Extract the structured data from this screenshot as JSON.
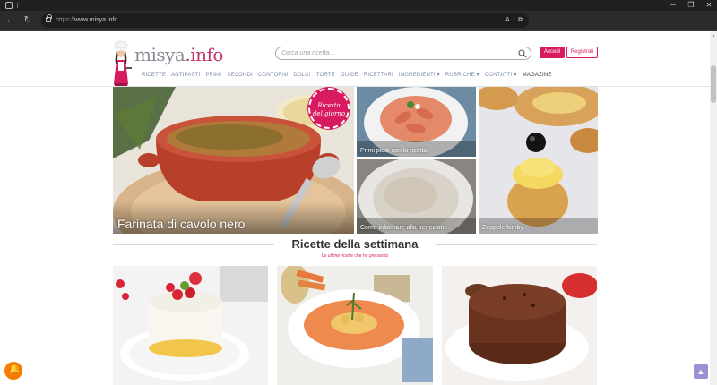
{
  "browser": {
    "url_prefix": "https://",
    "url_host": "www.misya.info",
    "reader_label": "A",
    "minimize": "─",
    "maximize": "❐",
    "close": "✕"
  },
  "site": {
    "logo_main": "misya",
    "logo_dot": ".info",
    "search_placeholder": "Cerca una ricetta...",
    "login_label": "Accedi",
    "register_label": "Registrati",
    "nav": [
      "RICETTE",
      "ANTIPASTI",
      "PRIMI",
      "SECONDI",
      "CONTORNI",
      "DOLCI",
      "TORTE",
      "GUIDE",
      "RICETTARI",
      "INGREDIENTI ▾",
      "RUBRICHE ▾",
      "CONTATTI ▾",
      "MAGAZINE"
    ]
  },
  "hero": {
    "main_caption": "Farinata di cavolo nero",
    "badge_line1": "Ricetta",
    "badge_line2": "del giorno",
    "tiles": [
      {
        "caption": "Primi piatti con la ricotta"
      },
      {
        "caption": "Come infarinare alla perfezione"
      },
      {
        "caption": "Zeppole bimby"
      }
    ]
  },
  "week": {
    "title": "Ricette della settimana",
    "subtitle": "Le ultime ricette che ho preparato"
  },
  "colors": {
    "accent": "#d81b60",
    "bell": "#f57c00",
    "to_top": "#9e8fd6"
  }
}
